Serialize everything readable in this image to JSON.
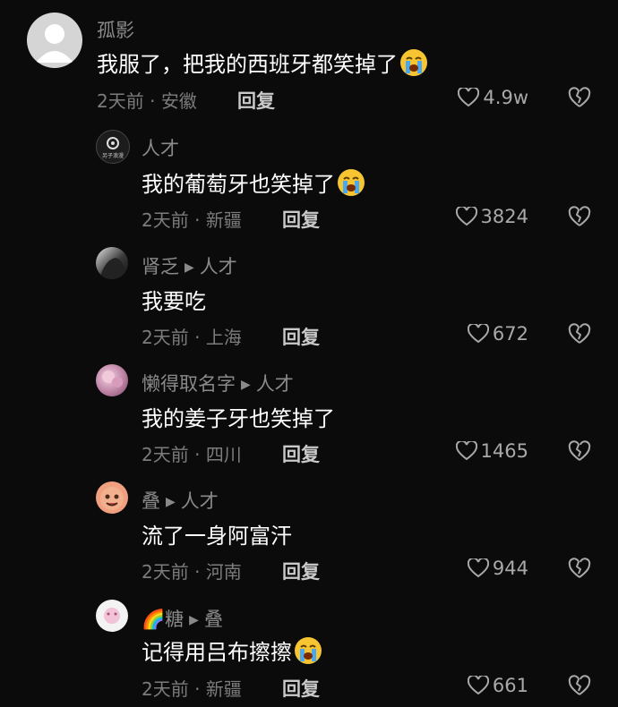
{
  "comments": [
    {
      "user": "孤影",
      "text": "我服了，把我的西班牙都笑掉了",
      "time": "2天前",
      "location": "安徽",
      "reply_label": "回复",
      "likes": "4.9w",
      "emoji": "loudly-crying-face"
    },
    {
      "user": "人才",
      "text": "我的葡萄牙也笑掉了",
      "time": "2天前",
      "location": "新疆",
      "reply_label": "回复",
      "likes": "3824",
      "emoji": "loudly-crying-face"
    },
    {
      "user": "肾乏",
      "reply_to": "人才",
      "text": "我要吃",
      "time": "2天前",
      "location": "上海",
      "reply_label": "回复",
      "likes": "672"
    },
    {
      "user": "懒得取名字",
      "reply_to": "人才",
      "text": "我的姜子牙也笑掉了",
      "time": "2天前",
      "location": "四川",
      "reply_label": "回复",
      "likes": "1465"
    },
    {
      "user": "叠",
      "reply_to": "人才",
      "text": "流了一身阿富汗",
      "time": "2天前",
      "location": "河南",
      "reply_label": "回复",
      "likes": "944"
    },
    {
      "user": "🌈糖",
      "reply_to": "叠",
      "text": "记得用吕布擦擦",
      "time": "2天前",
      "location": "新疆",
      "reply_label": "回复",
      "likes": "661",
      "emoji": "loudly-crying-face"
    }
  ],
  "meta_separator": " · ",
  "avatar_text": "另子浪漫",
  "colors": {
    "background": "#0b0b0b",
    "username": "#8a8a8a",
    "text": "#ffffff",
    "meta": "#7c7c7c",
    "reply": "#c9c9c9"
  }
}
